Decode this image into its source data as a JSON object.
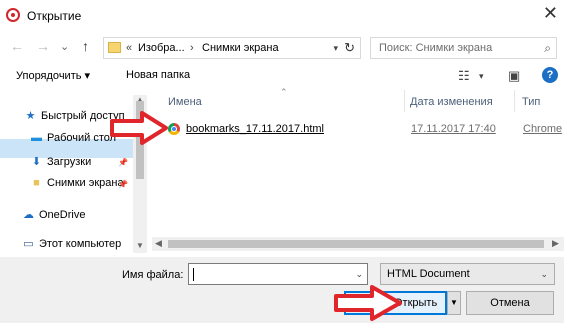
{
  "window": {
    "title": "Открытие",
    "close_glyph": "✕"
  },
  "nav": {
    "back": "←",
    "forward": "→",
    "recent": "⌄",
    "up": "↑"
  },
  "address": {
    "overflow": "«",
    "crumbs": [
      "Изобра...",
      "Снимки экрана"
    ],
    "separator": "›"
  },
  "search": {
    "placeholder": "Поиск: Снимки экрана"
  },
  "toolbar": {
    "organize_label": "Упорядочить ▾",
    "new_folder_label": "Новая папка",
    "help_label": "?"
  },
  "sidebar": {
    "items": [
      {
        "label": "Быстрый доступ",
        "icon": "star-icon"
      },
      {
        "label": "Рабочий стол",
        "icon": "desktop-icon"
      },
      {
        "label": "Загрузки",
        "icon": "download-icon"
      },
      {
        "label": "Снимки экрана",
        "icon": "folder-icon"
      },
      {
        "label": "OneDrive",
        "icon": "cloud-icon"
      },
      {
        "label": "Этот компьютер",
        "icon": "computer-icon"
      }
    ]
  },
  "columns": {
    "name": "Имена",
    "date": "Дата изменения",
    "type": "Тип"
  },
  "files": [
    {
      "name": "bookmarks_17.11.2017.html",
      "date": "17.11.2017 17:40",
      "type": "Chrome"
    }
  ],
  "footer": {
    "filename_label": "Имя файла:",
    "filename_value": "",
    "filetype_value": "HTML Document",
    "open_label": "Открыть",
    "cancel_label": "Отмена"
  },
  "colors": {
    "selection": "#cce4f7",
    "primary_border": "#0078d7",
    "annotation_arrow": "#e0262b"
  }
}
